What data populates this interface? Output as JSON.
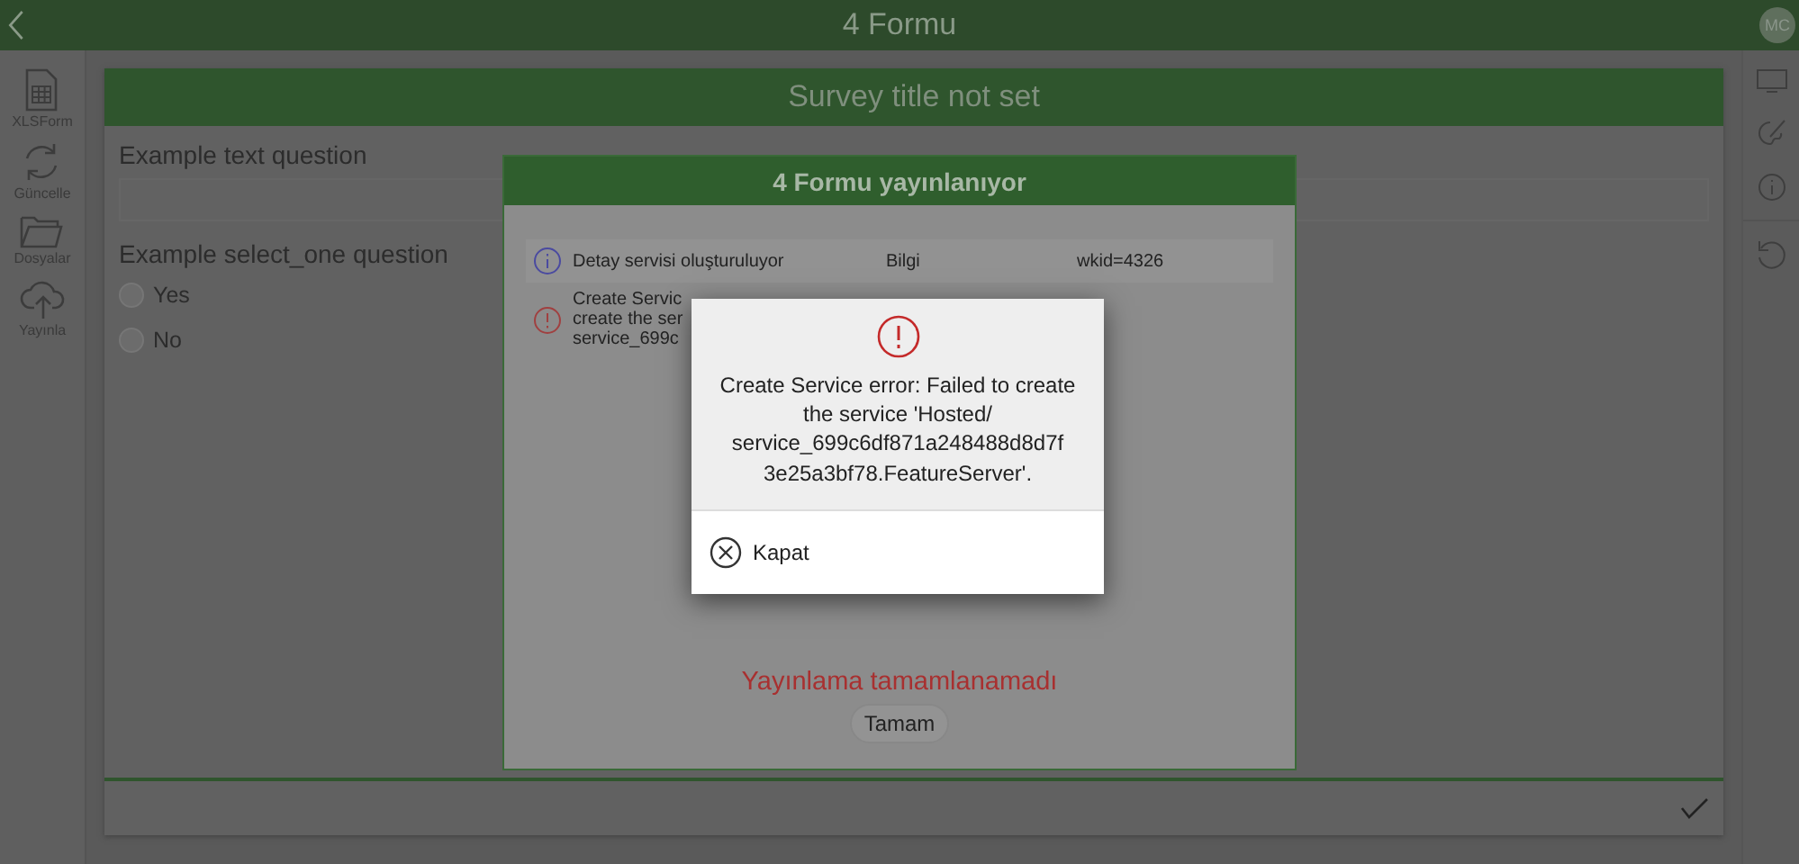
{
  "app_bar": {
    "title": "4 Formu",
    "avatar": "MC"
  },
  "sidebar": {
    "items": [
      {
        "kind": "spreadsheet",
        "label": "XLSForm"
      },
      {
        "kind": "refresh",
        "label": "Güncelle"
      },
      {
        "kind": "folder",
        "label": "Dosyalar"
      },
      {
        "kind": "upload",
        "label": "Yayınla"
      }
    ]
  },
  "survey": {
    "title": "Survey title not set",
    "questions": [
      {
        "kind": "text",
        "label": "Example text question"
      },
      {
        "kind": "select_one",
        "label": "Example select_one question",
        "choices": [
          {
            "label": "Yes",
            "selected": false
          },
          {
            "label": "No",
            "selected": false
          }
        ]
      }
    ]
  },
  "publish_dialog": {
    "title": "4 Formu yayınlanıyor",
    "log": [
      {
        "kind": "info",
        "lines": [
          "Detay servisi oluşturuluyor"
        ],
        "type": "Bilgi",
        "detail": "wkid=4326"
      },
      {
        "kind": "error",
        "lines": [
          "Create Servic",
          "create the ser",
          "service_699c"
        ]
      }
    ],
    "status": "Yayınlama tamamlanamadı",
    "button": "Tamam"
  },
  "error_dialog": {
    "message": "Create Service error: Failed to create the service 'Hosted/ service_699c6df871a248488d8d7f 3e25a3bf78.FeatureServer'.",
    "button": "Kapat"
  }
}
